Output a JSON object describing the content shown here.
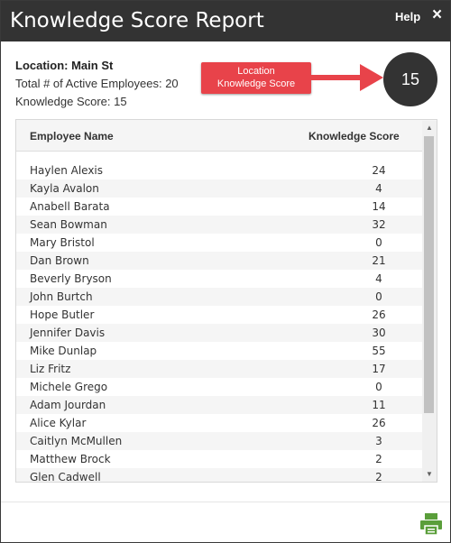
{
  "dialog": {
    "title": "Knowledge Score Report",
    "help_label": "Help",
    "close_glyph": "×"
  },
  "info": {
    "location": "Location: Main St",
    "total_employees": "Total # of Active Employees: 20",
    "knowledge_score": "Knowledge Score: 15"
  },
  "annotation": {
    "line1": "Location",
    "line2": "Knowledge Score",
    "color": "#e8434a"
  },
  "score_badge": "15",
  "table": {
    "headers": {
      "name": "Employee Name",
      "score": "Knowledge Score"
    },
    "rows": [
      {
        "name": "Haylen Alexis",
        "score": "24"
      },
      {
        "name": "Kayla Avalon",
        "score": "4"
      },
      {
        "name": "Anabell Barata",
        "score": "14"
      },
      {
        "name": "Sean Bowman",
        "score": "32"
      },
      {
        "name": "Mary Bristol",
        "score": "0"
      },
      {
        "name": "Dan Brown",
        "score": "21"
      },
      {
        "name": "Beverly Bryson",
        "score": "4"
      },
      {
        "name": "John Burtch",
        "score": "0"
      },
      {
        "name": "Hope Butler",
        "score": "26"
      },
      {
        "name": "Jennifer Davis",
        "score": "30"
      },
      {
        "name": "Mike Dunlap",
        "score": "55"
      },
      {
        "name": "Liz Fritz",
        "score": "17"
      },
      {
        "name": "Michele Grego",
        "score": "0"
      },
      {
        "name": "Adam Jourdan",
        "score": "11"
      },
      {
        "name": "Alice Kylar",
        "score": "26"
      },
      {
        "name": "Caitlyn McMullen",
        "score": "3"
      },
      {
        "name": "Matthew Brock",
        "score": "2"
      },
      {
        "name": "Glen Cadwell",
        "score": "2"
      }
    ]
  },
  "icons": {
    "print": "printer-icon",
    "print_color": "#5a9e3a",
    "scroll_up": "▲",
    "scroll_down": "▼"
  }
}
